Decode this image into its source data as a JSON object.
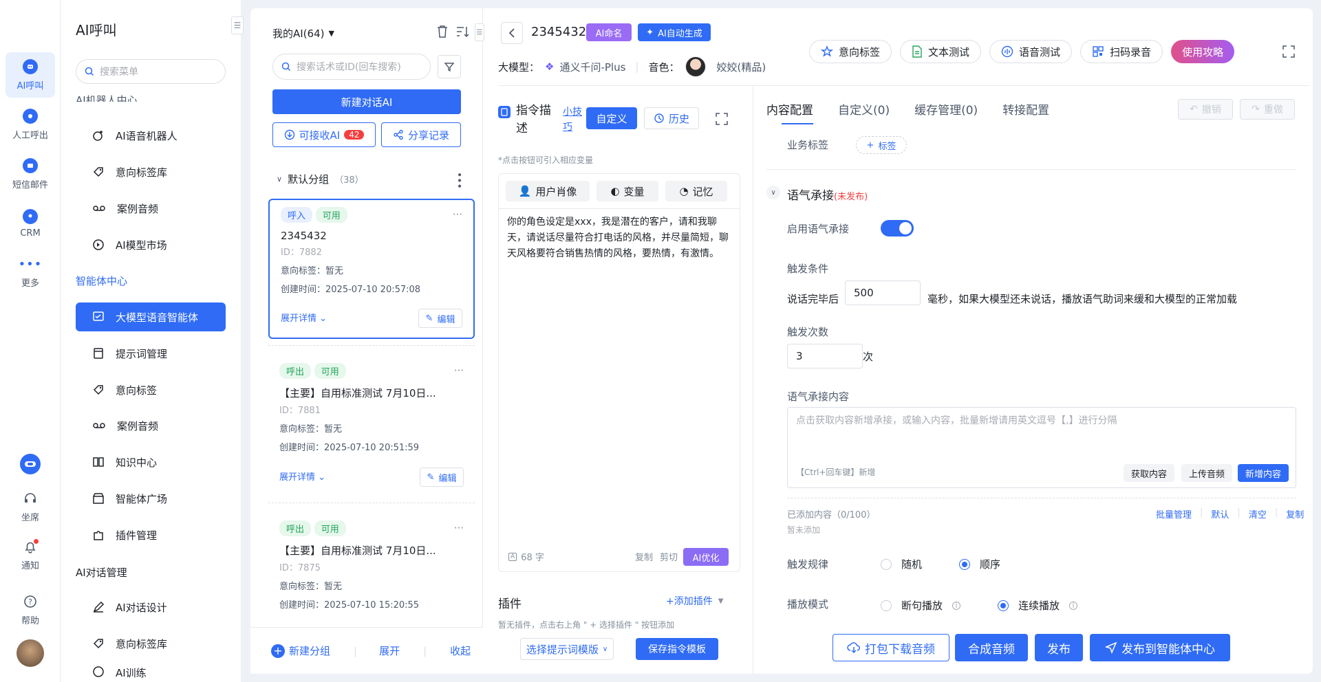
{
  "rail": {
    "items": [
      {
        "label": "AI呼叫",
        "icon": "robot-icon"
      },
      {
        "label": "人工呼出",
        "icon": "phone-icon"
      },
      {
        "label": "短信邮件",
        "icon": "message-icon"
      },
      {
        "label": "CRM",
        "icon": "crm-icon"
      },
      {
        "label": "更多",
        "icon": "more-icon"
      }
    ],
    "bottom": {
      "seat": "坐席",
      "notify": "通知",
      "help": "帮助"
    }
  },
  "menu": {
    "title": "AI呼叫",
    "search_placeholder": "搜索菜单",
    "group_partial": "AI机器人中心",
    "items_a": [
      "AI语音机器人",
      "意向标签库",
      "案例音频",
      "AI模型市场"
    ],
    "group_agent": "智能体中心",
    "items_b": [
      "大模型语音智能体",
      "提示词管理",
      "意向标签",
      "案例音频",
      "知识中心",
      "智能体广场",
      "插件管理"
    ],
    "group_dialog": "AI对话管理",
    "items_c": [
      "AI对话设计",
      "意向标签库",
      "AI训练"
    ]
  },
  "list": {
    "title": "我的AI(64)",
    "search_placeholder": "搜索话术或ID(回车搜索)",
    "new_button": "新建对话AI",
    "receive_button": "可接收AI",
    "receive_count": "42",
    "share_button": "分享记录",
    "group_name": "默认分组",
    "group_count": "（38）",
    "cards": [
      {
        "type": "呼入",
        "status": "可用",
        "name": "2345432",
        "id": "ID：7882",
        "tag": "意向标签：暂无",
        "created": "创建时间：2025-07-10 20:57:08"
      },
      {
        "type": "呼出",
        "status": "可用",
        "name": "【主要】自用标准测试 7月10日...",
        "id": "ID：7881",
        "tag": "意向标签：暂无",
        "created": "创建时间：2025-07-10 20:51:59"
      },
      {
        "type": "呼出",
        "status": "可用",
        "name": "【主要】自用标准测试 7月10日...",
        "id": "ID：7875",
        "tag": "意向标签：暂无",
        "created": "创建时间：2025-07-10 15:20:55"
      }
    ],
    "expand_detail": "展开详情",
    "edit": "编辑",
    "footer": {
      "new_group": "新建分组",
      "expand": "展开",
      "collapse": "收起"
    }
  },
  "header": {
    "name": "2345432",
    "ai_name": "AI命名",
    "ai_auto": "AI自动生成",
    "model_label": "大模型：",
    "model_value": "通义千问-Plus",
    "voice_label": "音色：",
    "voice_value": "姣姣(精品)",
    "actions": [
      "意向标签",
      "文本测试",
      "语音测试",
      "扫码录音"
    ],
    "guide": "使用攻略"
  },
  "editor": {
    "title": "指令描述",
    "tip": "小技巧",
    "custom": "自定义",
    "history": "历史",
    "hint": "*点击按钮可引入相应变量",
    "tools": [
      "用户肖像",
      "变量",
      "记忆"
    ],
    "content": "你的角色设定是xxx，我是潜在的客户，请和我聊天，请说话尽量符合打电话的风格，并尽量简短，聊天风格要符合销售热情的风格，要热情，有激情。",
    "count": "68 字",
    "copy": "复制",
    "cut": "剪切",
    "optimize": "AI优化",
    "plugin_title": "插件",
    "add_plugin": "+添加插件",
    "plugin_hint": "暂无插件，点击右上角 \" + 选择插件 \" 按钮添加",
    "select_template": "选择提示词模版",
    "save_template": "保存指令模板"
  },
  "config": {
    "tabs": [
      "内容配置",
      "自定义(0)",
      "缓存管理(0)",
      "转接配置"
    ],
    "undo": "撤销",
    "redo": "重做",
    "biz_tag_label": "业务标签",
    "biz_tag_btn": "标签",
    "section_title": "语气承接",
    "section_status": "(未发布)",
    "enable_label": "启用语气承接",
    "trigger_cond": "触发条件",
    "after_speech": "说话完毕后",
    "ms_value": "500",
    "ms_desc": "毫秒，如果大模型还未说话，播放语气助词来缓和大模型的正常加载",
    "trigger_times": "触发次数",
    "times_value": "3",
    "times_unit": "次",
    "content_label": "语气承接内容",
    "content_placeholder": "点击获取内容新增承接，或输入内容，批量新增请用英文逗号【,】进行分隔",
    "shortcut": "【Ctrl+回车键】新增",
    "get_content": "获取内容",
    "upload_audio": "上传音频",
    "add_content": "新增内容",
    "added": "已添加内容（0/100）",
    "batch": "批量管理",
    "default": "默认",
    "clear": "清空",
    "copy": "复制",
    "empty": "暂未添加",
    "rule_label": "触发规律",
    "rule_random": "随机",
    "rule_order": "顺序",
    "mode_label": "播放模式",
    "mode_break": "断句播放",
    "mode_cont": "连续播放",
    "btn_download": "打包下载音频",
    "btn_synth": "合成音频",
    "btn_publish": "发布",
    "btn_publish_center": "发布到智能体中心"
  }
}
